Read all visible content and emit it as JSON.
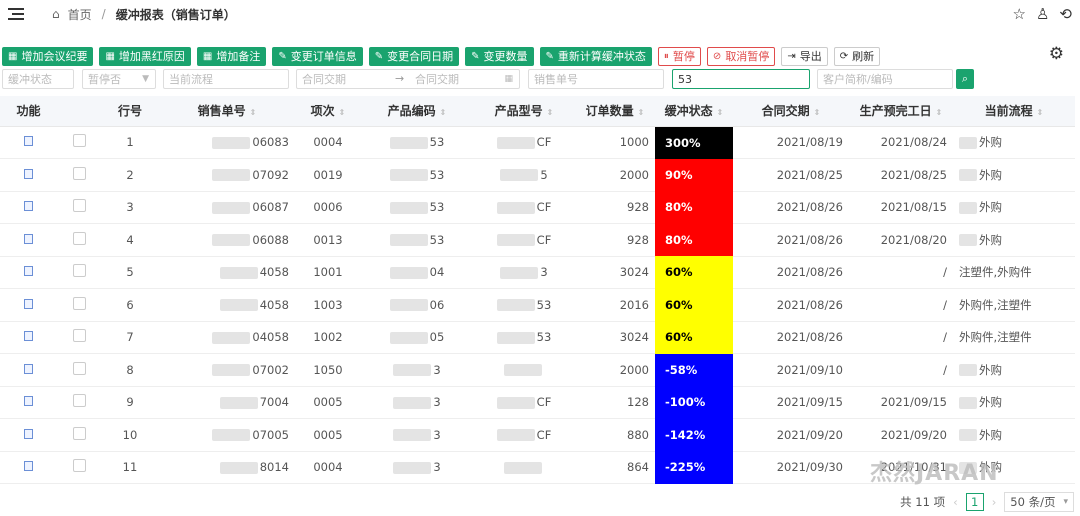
{
  "breadcrumb": {
    "home": "首页",
    "separator": "/",
    "current": "缓冲报表（销售订单）"
  },
  "toolbar": {
    "buttons": [
      {
        "label": "增加会议纪要",
        "style": "green",
        "icon": "grid"
      },
      {
        "label": "增加黑红原因",
        "style": "green",
        "icon": "grid"
      },
      {
        "label": "增加备注",
        "style": "green",
        "icon": "grid"
      },
      {
        "label": "变更订单信息",
        "style": "green",
        "icon": "pencil"
      },
      {
        "label": "变更合同日期",
        "style": "green",
        "icon": "pencil"
      },
      {
        "label": "变更数量",
        "style": "green",
        "icon": "pencil"
      },
      {
        "label": "重新计算缓冲状态",
        "style": "green",
        "icon": "pencil"
      },
      {
        "label": "暂停",
        "style": "red",
        "icon": "pause"
      },
      {
        "label": "取消暂停",
        "style": "red",
        "icon": "cancel"
      },
      {
        "label": "导出",
        "style": "plain",
        "icon": "export"
      },
      {
        "label": "刷新",
        "style": "plain",
        "icon": "refresh"
      }
    ]
  },
  "filters": {
    "buffer_status": {
      "placeholder": "缓冲状态"
    },
    "paused": {
      "placeholder": "暂停否"
    },
    "current_flow": {
      "placeholder": "当前流程"
    },
    "contract_date_from": {
      "placeholder": "合同交期"
    },
    "contract_date_to": {
      "placeholder": "合同交期"
    },
    "arrow": "→",
    "order_no": {
      "placeholder": "销售单号"
    },
    "keyword": {
      "value": "53"
    },
    "customer": {
      "placeholder": "客户简称/编码"
    }
  },
  "table": {
    "headers": [
      "功能",
      "",
      "行号",
      "销售单号",
      "项次",
      "产品编码",
      "产品型号",
      "订单数量",
      "缓冲状态",
      "合同交期",
      "生产预完工日",
      "当前流程"
    ],
    "rows": [
      {
        "row": "1",
        "order": "06083",
        "item": "0004",
        "code": "53",
        "model": "CF",
        "qty": "1000",
        "buffer": "300%",
        "color": "#000000",
        "contract": "2021/08/19",
        "finish": "2021/08/24",
        "flow": "外购"
      },
      {
        "row": "2",
        "order": "07092",
        "item": "0019",
        "code": "53",
        "model": "5",
        "qty": "2000",
        "buffer": "90%",
        "color": "#ff0000",
        "contract": "2021/08/25",
        "finish": "2021/08/25",
        "flow": "外购"
      },
      {
        "row": "3",
        "order": "06087",
        "item": "0006",
        "code": "53",
        "model": "CF",
        "qty": "928",
        "buffer": "80%",
        "color": "#ff0000",
        "contract": "2021/08/26",
        "finish": "2021/08/15",
        "flow": "外购"
      },
      {
        "row": "4",
        "order": "06088",
        "item": "0013",
        "code": "53",
        "model": "CF",
        "qty": "928",
        "buffer": "80%",
        "color": "#ff0000",
        "contract": "2021/08/26",
        "finish": "2021/08/20",
        "flow": "外购"
      },
      {
        "row": "5",
        "order": "4058",
        "item": "1001",
        "code": "04",
        "model": "3",
        "qty": "3024",
        "buffer": "60%",
        "color": "#ffff00",
        "contract": "2021/08/26",
        "finish": "/",
        "flow": "注塑件,外购件"
      },
      {
        "row": "6",
        "order": "4058",
        "item": "1003",
        "code": "06",
        "model": "53",
        "qty": "2016",
        "buffer": "60%",
        "color": "#ffff00",
        "contract": "2021/08/26",
        "finish": "/",
        "flow": "外购件,注塑件"
      },
      {
        "row": "7",
        "order": "04058",
        "item": "1002",
        "code": "05",
        "model": "53",
        "qty": "3024",
        "buffer": "60%",
        "color": "#ffff00",
        "contract": "2021/08/26",
        "finish": "/",
        "flow": "外购件,注塑件"
      },
      {
        "row": "8",
        "order": "07002",
        "item": "1050",
        "code": "3",
        "model": "",
        "qty": "2000",
        "buffer": "-58%",
        "color": "#0000ff",
        "contract": "2021/09/10",
        "finish": "/",
        "flow": "外购"
      },
      {
        "row": "9",
        "order": "7004",
        "item": "0005",
        "code": "3",
        "model": "CF",
        "qty": "128",
        "buffer": "-100%",
        "color": "#0000ff",
        "contract": "2021/09/15",
        "finish": "2021/09/15",
        "flow": "外购"
      },
      {
        "row": "10",
        "order": "07005",
        "item": "0005",
        "code": "3",
        "model": "CF",
        "qty": "880",
        "buffer": "-142%",
        "color": "#0000ff",
        "contract": "2021/09/20",
        "finish": "2021/09/20",
        "flow": "外购"
      },
      {
        "row": "11",
        "order": "8014",
        "item": "0004",
        "code": "3",
        "model": "",
        "qty": "864",
        "buffer": "-225%",
        "color": "#0000ff",
        "contract": "2021/09/30",
        "finish": "2021/10/31",
        "flow": "外购"
      }
    ]
  },
  "pagination": {
    "total": "共 11 项",
    "prev": "‹",
    "current": "1",
    "next": "›",
    "page_size": "50 条/页",
    "page_size_arrow": "▾"
  },
  "watermark": "杰然JARAN",
  "colors": {
    "accent": "#1aa36e",
    "danger": "#e04b4b"
  }
}
